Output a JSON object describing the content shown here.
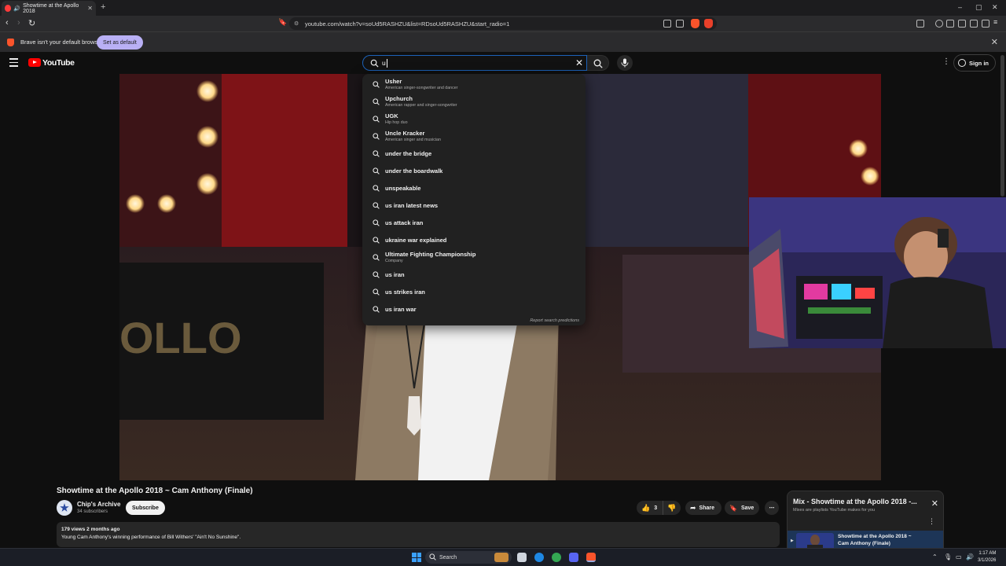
{
  "browser": {
    "tab_title": "Showtime at the Apollo 2018",
    "url": "youtube.com/watch?v=soUd5RASHZU&list=RDsoUd5RASHZU&start_radio=1",
    "infobar_message": "Brave isn't your default browser",
    "set_default_label": "Set as default"
  },
  "masthead": {
    "logo_text": "YouTube",
    "search_value": "u",
    "sign_in_label": "Sign in"
  },
  "suggestions": [
    {
      "text": "Usher",
      "sub": "American singer-songwriter and dancer"
    },
    {
      "text": "Upchurch",
      "sub": "American rapper and singer-songwriter"
    },
    {
      "text": "UGK",
      "sub": "Hip hop duo"
    },
    {
      "text": "Uncle Kracker",
      "sub": "American singer and musician"
    },
    {
      "text": "under the bridge",
      "sub": ""
    },
    {
      "text": "under the boardwalk",
      "sub": ""
    },
    {
      "text": "unspeakable",
      "sub": ""
    },
    {
      "text": "us iran latest news",
      "sub": ""
    },
    {
      "text": "us attack iran",
      "sub": ""
    },
    {
      "text": "ukraine war explained",
      "sub": ""
    },
    {
      "text": "Ultimate Fighting Championship",
      "sub": "Company"
    },
    {
      "text": "us iran",
      "sub": ""
    },
    {
      "text": "us strikes iran",
      "sub": ""
    },
    {
      "text": "us iran war",
      "sub": ""
    }
  ],
  "report_label": "Report search predictions",
  "video": {
    "title": "Showtime at the Apollo 2018 ~ Cam Anthony (Finale)",
    "channel": "Chip's Archive",
    "subscribers": "34 subscribers",
    "subscribe_label": "Subscribe",
    "likes": "3",
    "share_label": "Share",
    "save_label": "Save",
    "meta": "179 views  2 months ago",
    "description": "Young Cam Anthony's winning performance of Bill Withers' \"Ain't No Sunshine\"."
  },
  "mix": {
    "title": "Mix - Showtime at the Apollo 2018 -...",
    "subtitle": "Mixes are playlists YouTube makes for you",
    "item_title_1": "Showtime at the Apollo 2018 ~",
    "item_title_2": "Cam Anthony (Finale)"
  },
  "taskbar": {
    "search_label": "Search",
    "time": "1:17 AM",
    "date": "3/1/2026"
  },
  "colors": {
    "accent_search_border": "#1c62b9",
    "yt_red": "#ff0000",
    "brave_orange": "#fb542b",
    "set_default_bg": "#b9b0f5"
  }
}
